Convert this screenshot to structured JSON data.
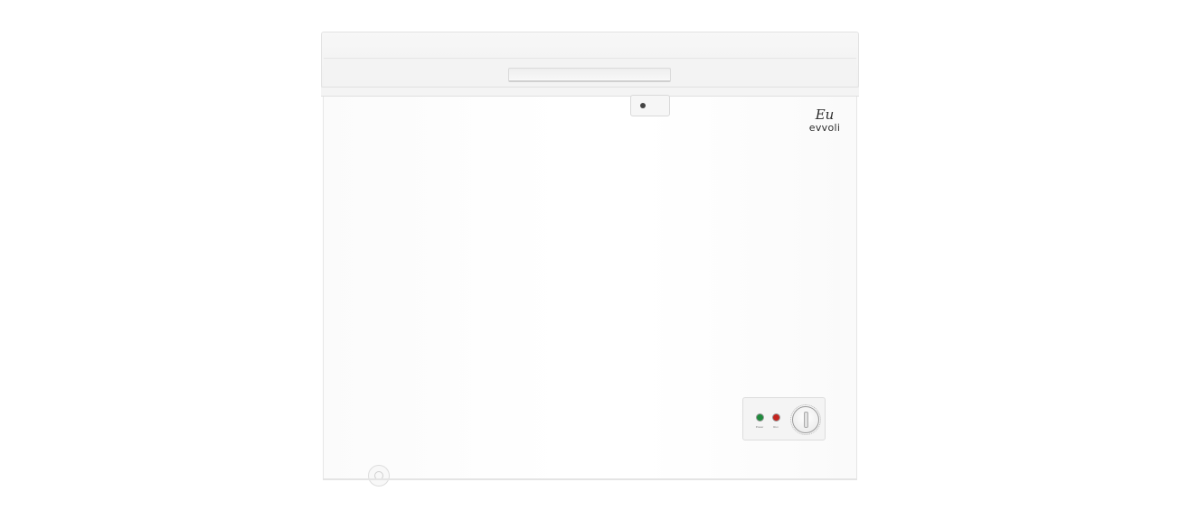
{
  "product": {
    "brand_mark": "Eu",
    "brand_name": "evvoli"
  },
  "control_panel": {
    "power_label": "Power",
    "run_label": "Run",
    "power_led_color": "#1f8a3c",
    "run_led_color": "#c4241e"
  }
}
